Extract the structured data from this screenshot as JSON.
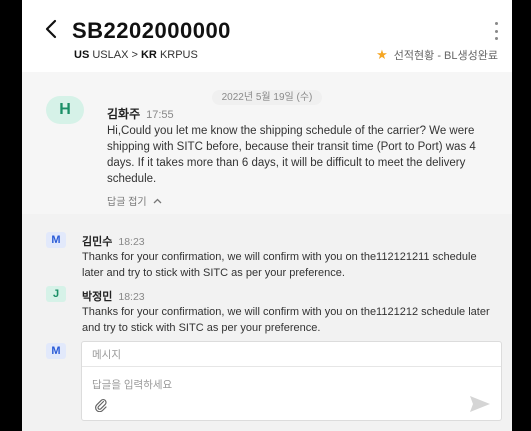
{
  "header": {
    "title": "SB2202000000",
    "origin_country": "US",
    "origin_port": "USLAX",
    "separator": ">",
    "dest_country": "KR",
    "dest_port": "KRPUS",
    "status_label": "선적현황 - BL생성완료",
    "star_icon": "star-icon"
  },
  "thread": {
    "date": "2022년 5월 19일 (수)",
    "message": {
      "avatar_letter": "H",
      "author": "김화주",
      "time": "17:55",
      "text": "Hi,Could you let me know the shipping schedule of the carrier? We were shipping with SITC before, because their transit time (Port to Port) was 4 days. If it takes more than 6 days, it will be difficult to meet the delivery schedule.",
      "fold_label": "답글 접기"
    },
    "replies": [
      {
        "avatar_letter": "M",
        "author": "김민수",
        "time": "18:23",
        "text": "Thanks for your confirmation, we will confirm with you on the112121211 schedule later and try to stick with SITC as per your preference."
      },
      {
        "avatar_letter": "J",
        "author": "박정민",
        "time": "18:23",
        "text": "Thanks for your confirmation, we will confirm with you on the1121212 schedule later and try to stick with SITC as per your preference."
      }
    ]
  },
  "composer": {
    "avatar_letter": "M",
    "subject_placeholder": "메시지",
    "body_placeholder": "답글을 입력하세요"
  },
  "colors": {
    "accent_green": "#1a8f66",
    "accent_blue": "#2a5bd7",
    "star": "#f5a623"
  }
}
